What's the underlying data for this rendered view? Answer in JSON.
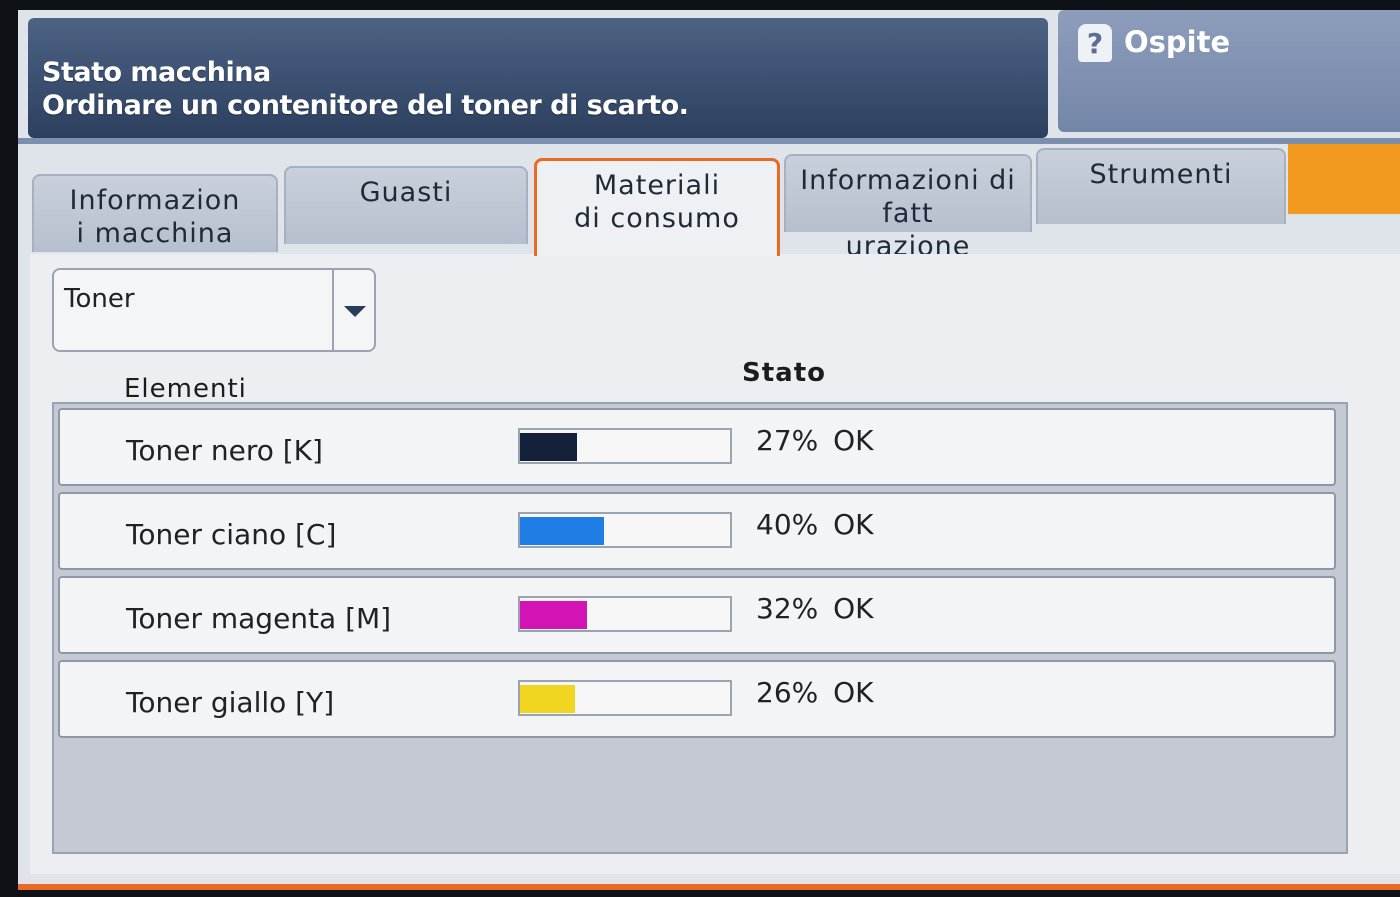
{
  "header": {
    "title": "Stato macchina",
    "message": "Ordinare un contenitore del toner di scarto.",
    "user_name": "Ospite",
    "user_icon": "user-help-icon"
  },
  "tabs": [
    {
      "label": "Informazioni macchina",
      "active": false
    },
    {
      "label": "Guasti",
      "active": false
    },
    {
      "label": "Materiali di consumo",
      "active": true
    },
    {
      "label": "Informazioni di fatturazione",
      "active": false
    },
    {
      "label": "Strumenti",
      "active": false
    }
  ],
  "filter": {
    "selected": "Toner"
  },
  "columns": {
    "items": "Elementi",
    "status": "Stato"
  },
  "toners": [
    {
      "label": "Toner nero [K]",
      "level": 27,
      "status": "27% OK",
      "color": "#15203a"
    },
    {
      "label": "Toner ciano [C]",
      "level": 40,
      "status": "40% OK",
      "color": "#1f7de6"
    },
    {
      "label": "Toner magenta [M]",
      "level": 32,
      "status": "32% OK",
      "color": "#d214b4"
    },
    {
      "label": "Toner giallo [Y]",
      "level": 26,
      "status": "26% OK",
      "color": "#f0d620"
    }
  ],
  "colors": {
    "accent": "#e96a22",
    "header_bg": "#2c3f5f"
  }
}
